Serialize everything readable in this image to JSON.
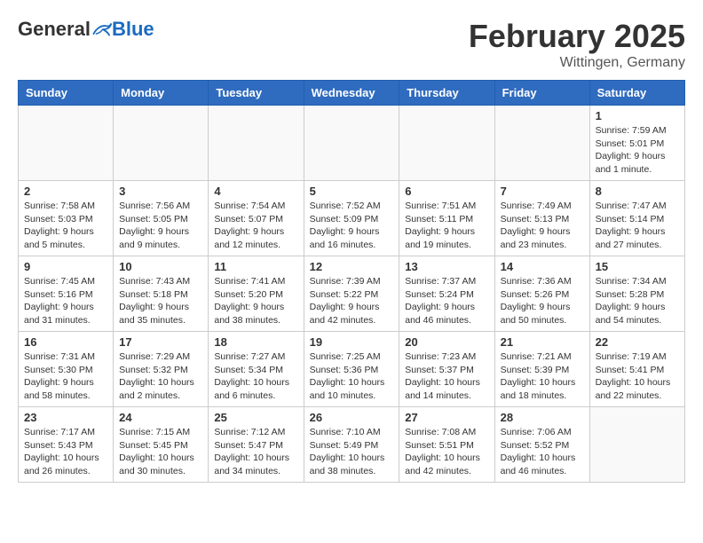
{
  "header": {
    "logo": {
      "general": "General",
      "blue": "Blue"
    },
    "title": "February 2025",
    "location": "Wittingen, Germany"
  },
  "days_of_week": [
    "Sunday",
    "Monday",
    "Tuesday",
    "Wednesday",
    "Thursday",
    "Friday",
    "Saturday"
  ],
  "weeks": [
    [
      {
        "day": "",
        "info": ""
      },
      {
        "day": "",
        "info": ""
      },
      {
        "day": "",
        "info": ""
      },
      {
        "day": "",
        "info": ""
      },
      {
        "day": "",
        "info": ""
      },
      {
        "day": "",
        "info": ""
      },
      {
        "day": "1",
        "info": "Sunrise: 7:59 AM\nSunset: 5:01 PM\nDaylight: 9 hours and 1 minute."
      }
    ],
    [
      {
        "day": "2",
        "info": "Sunrise: 7:58 AM\nSunset: 5:03 PM\nDaylight: 9 hours and 5 minutes."
      },
      {
        "day": "3",
        "info": "Sunrise: 7:56 AM\nSunset: 5:05 PM\nDaylight: 9 hours and 9 minutes."
      },
      {
        "day": "4",
        "info": "Sunrise: 7:54 AM\nSunset: 5:07 PM\nDaylight: 9 hours and 12 minutes."
      },
      {
        "day": "5",
        "info": "Sunrise: 7:52 AM\nSunset: 5:09 PM\nDaylight: 9 hours and 16 minutes."
      },
      {
        "day": "6",
        "info": "Sunrise: 7:51 AM\nSunset: 5:11 PM\nDaylight: 9 hours and 19 minutes."
      },
      {
        "day": "7",
        "info": "Sunrise: 7:49 AM\nSunset: 5:13 PM\nDaylight: 9 hours and 23 minutes."
      },
      {
        "day": "8",
        "info": "Sunrise: 7:47 AM\nSunset: 5:14 PM\nDaylight: 9 hours and 27 minutes."
      }
    ],
    [
      {
        "day": "9",
        "info": "Sunrise: 7:45 AM\nSunset: 5:16 PM\nDaylight: 9 hours and 31 minutes."
      },
      {
        "day": "10",
        "info": "Sunrise: 7:43 AM\nSunset: 5:18 PM\nDaylight: 9 hours and 35 minutes."
      },
      {
        "day": "11",
        "info": "Sunrise: 7:41 AM\nSunset: 5:20 PM\nDaylight: 9 hours and 38 minutes."
      },
      {
        "day": "12",
        "info": "Sunrise: 7:39 AM\nSunset: 5:22 PM\nDaylight: 9 hours and 42 minutes."
      },
      {
        "day": "13",
        "info": "Sunrise: 7:37 AM\nSunset: 5:24 PM\nDaylight: 9 hours and 46 minutes."
      },
      {
        "day": "14",
        "info": "Sunrise: 7:36 AM\nSunset: 5:26 PM\nDaylight: 9 hours and 50 minutes."
      },
      {
        "day": "15",
        "info": "Sunrise: 7:34 AM\nSunset: 5:28 PM\nDaylight: 9 hours and 54 minutes."
      }
    ],
    [
      {
        "day": "16",
        "info": "Sunrise: 7:31 AM\nSunset: 5:30 PM\nDaylight: 9 hours and 58 minutes."
      },
      {
        "day": "17",
        "info": "Sunrise: 7:29 AM\nSunset: 5:32 PM\nDaylight: 10 hours and 2 minutes."
      },
      {
        "day": "18",
        "info": "Sunrise: 7:27 AM\nSunset: 5:34 PM\nDaylight: 10 hours and 6 minutes."
      },
      {
        "day": "19",
        "info": "Sunrise: 7:25 AM\nSunset: 5:36 PM\nDaylight: 10 hours and 10 minutes."
      },
      {
        "day": "20",
        "info": "Sunrise: 7:23 AM\nSunset: 5:37 PM\nDaylight: 10 hours and 14 minutes."
      },
      {
        "day": "21",
        "info": "Sunrise: 7:21 AM\nSunset: 5:39 PM\nDaylight: 10 hours and 18 minutes."
      },
      {
        "day": "22",
        "info": "Sunrise: 7:19 AM\nSunset: 5:41 PM\nDaylight: 10 hours and 22 minutes."
      }
    ],
    [
      {
        "day": "23",
        "info": "Sunrise: 7:17 AM\nSunset: 5:43 PM\nDaylight: 10 hours and 26 minutes."
      },
      {
        "day": "24",
        "info": "Sunrise: 7:15 AM\nSunset: 5:45 PM\nDaylight: 10 hours and 30 minutes."
      },
      {
        "day": "25",
        "info": "Sunrise: 7:12 AM\nSunset: 5:47 PM\nDaylight: 10 hours and 34 minutes."
      },
      {
        "day": "26",
        "info": "Sunrise: 7:10 AM\nSunset: 5:49 PM\nDaylight: 10 hours and 38 minutes."
      },
      {
        "day": "27",
        "info": "Sunrise: 7:08 AM\nSunset: 5:51 PM\nDaylight: 10 hours and 42 minutes."
      },
      {
        "day": "28",
        "info": "Sunrise: 7:06 AM\nSunset: 5:52 PM\nDaylight: 10 hours and 46 minutes."
      },
      {
        "day": "",
        "info": ""
      }
    ]
  ]
}
